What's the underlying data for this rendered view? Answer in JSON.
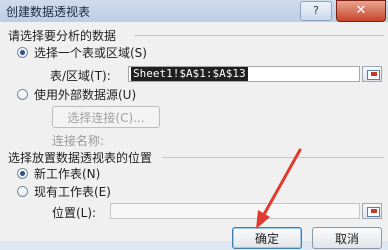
{
  "window": {
    "title": "创建数据透视表",
    "help_label": "?",
    "close_label": "✕"
  },
  "source_section": {
    "heading": "请选择要分析的数据",
    "option_table": {
      "label": "选择一个表或区域(S)",
      "selected": true
    },
    "range_label": "表/区域(T):",
    "range_value": "Sheet1!$A$1:$A$13",
    "option_external": {
      "label": "使用外部数据源(U)",
      "selected": false
    },
    "choose_connection_label": "选择连接(C)...",
    "connection_name_label": "连接名称:"
  },
  "location_section": {
    "heading": "选择放置数据透视表的位置",
    "option_new_sheet": {
      "label": "新工作表(N)",
      "selected": true
    },
    "option_existing_sheet": {
      "label": "现有工作表(E)",
      "selected": false
    },
    "location_label": "位置(L):",
    "location_value": ""
  },
  "buttons": {
    "ok_label": "确定",
    "cancel_label": "取消"
  },
  "colors": {
    "annotation_arrow": "#e23b2e",
    "close_button": "#c8452b",
    "selection_highlight": "#202020"
  },
  "icons": {
    "range_picker": "range-picker-icon"
  }
}
